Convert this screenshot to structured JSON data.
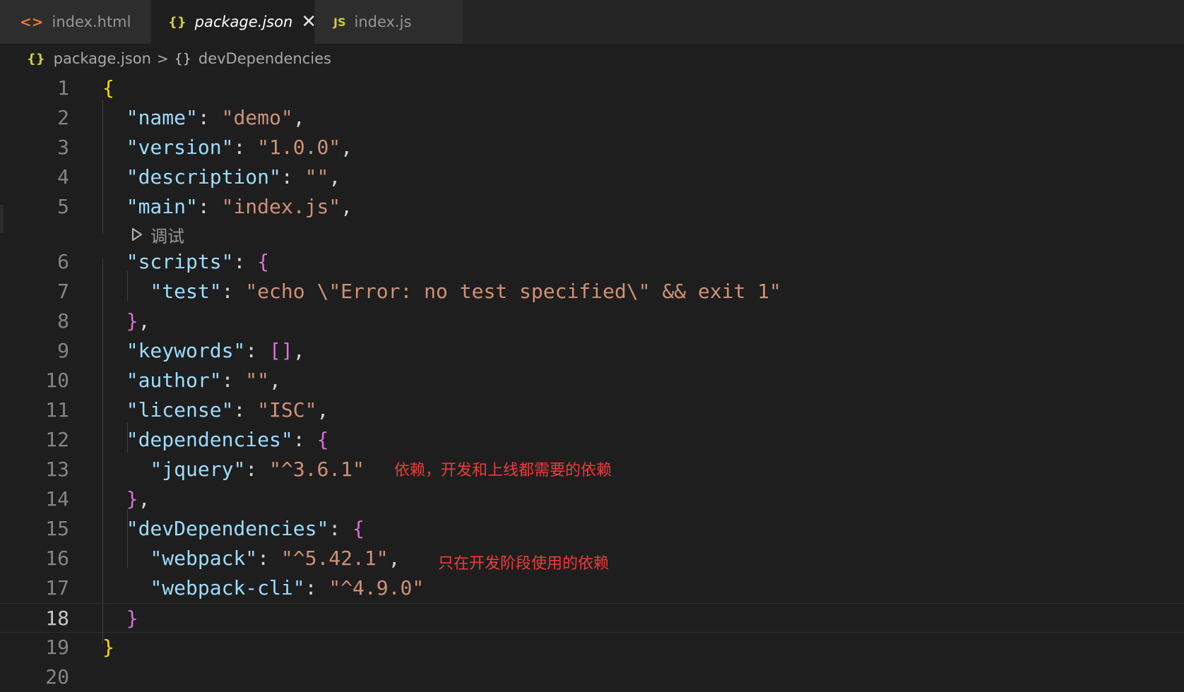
{
  "tabs": [
    {
      "label": "index.html",
      "icon": "html-file-icon",
      "glyph": "<>"
    },
    {
      "label": "package.json",
      "icon": "json-file-icon",
      "glyph": "{}",
      "active": true
    },
    {
      "label": "index.js",
      "icon": "js-file-icon",
      "glyph": "JS"
    }
  ],
  "breadcrumb": {
    "file_icon": "{}",
    "file": "package.json",
    "separator": ">",
    "symbol_icon": "{}",
    "symbol": "devDependencies"
  },
  "codelens": {
    "label": "调试",
    "icon": "debug-play-icon"
  },
  "lines": [
    {
      "n": "1"
    },
    {
      "n": "2"
    },
    {
      "n": "3"
    },
    {
      "n": "4"
    },
    {
      "n": "5"
    },
    {
      "n": "6"
    },
    {
      "n": "7"
    },
    {
      "n": "8"
    },
    {
      "n": "9"
    },
    {
      "n": "10"
    },
    {
      "n": "11"
    },
    {
      "n": "12"
    },
    {
      "n": "13"
    },
    {
      "n": "14"
    },
    {
      "n": "15"
    },
    {
      "n": "16"
    },
    {
      "n": "17"
    },
    {
      "n": "18"
    },
    {
      "n": "19"
    },
    {
      "n": "20"
    }
  ],
  "code": {
    "l1_open": "{",
    "name_key": "\"name\"",
    "name_val": "\"demo\"",
    "version_key": "\"version\"",
    "version_val": "\"1.0.0\"",
    "description_key": "\"description\"",
    "description_val": "\"\"",
    "main_key": "\"main\"",
    "main_val": "\"index.js\"",
    "scripts_key": "\"scripts\"",
    "scripts_open": "{",
    "test_key": "\"test\"",
    "test_val": "\"echo \\\"Error: no test specified\\\" && exit 1\"",
    "scripts_close": "}",
    "keywords_key": "\"keywords\"",
    "keywords_val": "[]",
    "author_key": "\"author\"",
    "author_val": "\"\"",
    "license_key": "\"license\"",
    "license_val": "\"ISC\"",
    "dependencies_key": "\"dependencies\"",
    "dependencies_open": "{",
    "jquery_key": "\"jquery\"",
    "jquery_val": "\"^3.6.1\"",
    "dependencies_close": "}",
    "devdeps_key": "\"devDependencies\"",
    "devdeps_open": "{",
    "webpack_key": "\"webpack\"",
    "webpack_val": "\"^5.42.1\"",
    "webpackcli_key": "\"webpack-cli\"",
    "webpackcli_val": "\"^4.9.0\"",
    "devdeps_close": "}",
    "root_close": "}"
  },
  "annotations": {
    "dependencies_note": "依赖，开发和上线都需要的依赖",
    "devdeps_note": "只在开发阶段使用的依赖"
  },
  "colors": {
    "background": "#1e1e1e",
    "json_key": "#9cdcfe",
    "json_string": "#ce9178",
    "bracket_level1": "#ffd700",
    "bracket_level2": "#da70d6",
    "annotation": "#f03a3a"
  }
}
